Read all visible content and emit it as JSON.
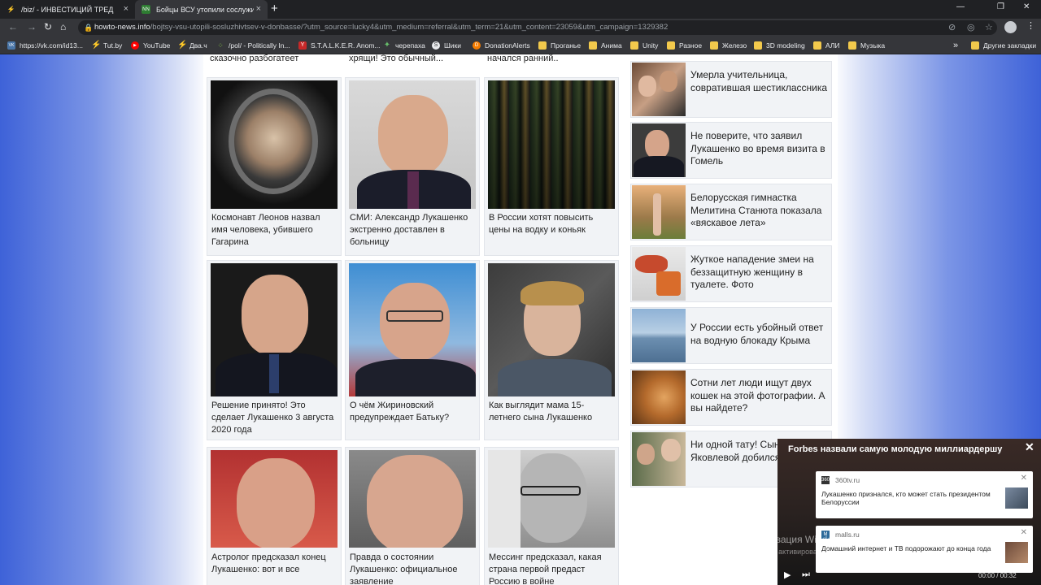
{
  "browser": {
    "tabs": [
      {
        "label": "/biz/ - ИНВЕСТИЦИЙ ТРЕД"
      },
      {
        "label": "Бойцы ВСУ утопили сослуживц",
        "favicon_text": "NN"
      }
    ],
    "url_host": "howto-news.info",
    "url_path": "/bojtsy-vsu-utopili-sosluzhivtsev-v-donbasse/?utm_source=lucky4&utm_medium=referral&utm_term=21&utm_content=23059&utm_campaign=1329382",
    "bookmarks": [
      {
        "label": "https://vk.com/id13...",
        "icon_text": "VK"
      },
      {
        "label": "Tut.by"
      },
      {
        "label": "YouTube"
      },
      {
        "label": "Два.ч"
      },
      {
        "label": "/pol/ - Politically In..."
      },
      {
        "label": "S.T.A.L.K.E.R. Anom..."
      },
      {
        "label": "черепаха"
      },
      {
        "label": "Шики"
      },
      {
        "label": "DonationAlerts"
      },
      {
        "label": "Проганье"
      },
      {
        "label": "Анима"
      },
      {
        "label": "Unity"
      },
      {
        "label": "Разное"
      },
      {
        "label": "Железо"
      },
      {
        "label": "3D modeling"
      },
      {
        "label": "АЛИ"
      },
      {
        "label": "Музыка"
      }
    ],
    "bookmarks_overflow": "»",
    "other_bookmarks": "Другие закладки"
  },
  "top_strip": [
    "сказочно разбогатеет",
    "хрящи! Это обычный...",
    "начался ранний.."
  ],
  "grid": [
    {
      "title": "Космонавт Леонов назвал имя человека, убившего Гагарина"
    },
    {
      "title": "СМИ: Александр Лукашенко экстренно доставлен в больницу"
    },
    {
      "title": "В России хотят повысить цены на водку и коньяк"
    },
    {
      "title": "Решение принято! Это сделает Лукашенко 3 августа 2020 года"
    },
    {
      "title": "О чём Жириновский предупреждает Батьку?"
    },
    {
      "title": "Как выглядит мама 15-летнего сына Лукашенко"
    },
    {
      "title": "Астролог предсказал конец Лукашенко: вот и все"
    },
    {
      "title": "Правда о состоянии Лукашенко: официальное заявление"
    },
    {
      "title": "Мессинг предсказал, какая страна первой предаст Россию в войне"
    }
  ],
  "sidebar": [
    {
      "title": "Умерла учительница, совратившая шестиклассника"
    },
    {
      "title": "Не поверите, что заявил Лукашенко во время визита в Гомель"
    },
    {
      "title": "Белорусская гимнастка Мелитина Станюта показала «вяскавое лета»"
    },
    {
      "title": "Жуткое нападение змеи на беззащитную женщину в туалете. Фото"
    },
    {
      "title": "У России есть убойный ответ на водную блокаду Крыма"
    },
    {
      "title": "Сотни лет люди ищут двух кошек на этой фотографии. А вы найдете?"
    },
    {
      "title": "Ни одной тату! Сын Яковлевой добился лица"
    }
  ],
  "popup": {
    "title": "Forbes назвали самую молодую миллиардершу",
    "notifications": [
      {
        "source": "360tv.ru",
        "icon_text": "360",
        "text": "Лукашенко признался, кто может стать президентом Белоруссии"
      },
      {
        "source": "malls.ru",
        "icon_text": "M",
        "text": "Домашний интернет и ТВ подорожают до конца года"
      }
    ],
    "time": "00:00 / 00:32"
  },
  "watermark": {
    "line1": "Активация Windows",
    "line2": "Чтобы активировать Windows, перейдите в раздел «Параметры»."
  }
}
